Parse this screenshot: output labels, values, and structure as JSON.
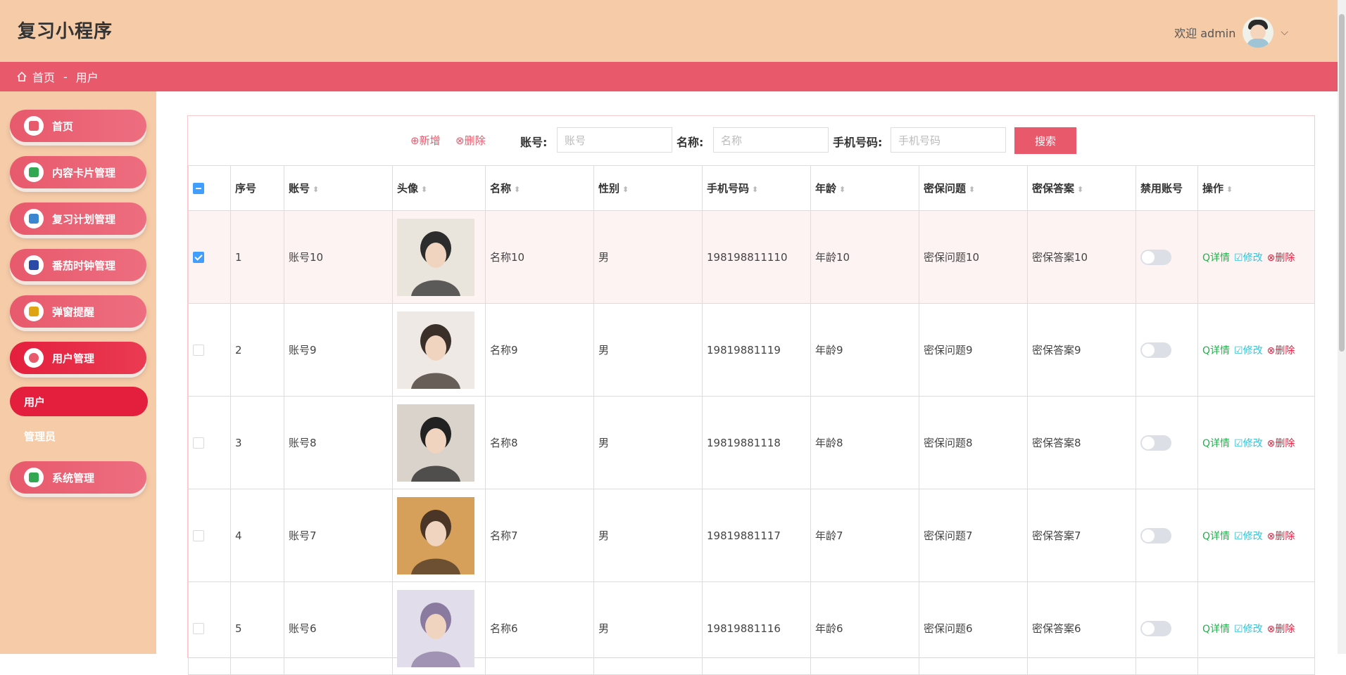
{
  "app_title": "复习小程序",
  "header": {
    "welcome": "欢迎 admin",
    "chevron": "⌵"
  },
  "breadcrumb": {
    "home": "首页",
    "sep": "-",
    "current": "用户"
  },
  "sidebar": {
    "items": [
      {
        "label": "首页",
        "icon": "home-icon",
        "color": "#e8596c"
      },
      {
        "label": "内容卡片管理",
        "icon": "card-icon",
        "color": "#33a852"
      },
      {
        "label": "复习计划管理",
        "icon": "building-icon",
        "color": "#3a86d1"
      },
      {
        "label": "番茄时钟管理",
        "icon": "book-icon",
        "color": "#2b4aa8"
      },
      {
        "label": "弹窗提醒",
        "icon": "folder-icon",
        "color": "#e0a412"
      },
      {
        "label": "用户管理",
        "icon": "user-icon",
        "color": "#e8596c"
      },
      {
        "label": "系统管理",
        "icon": "stack-icon",
        "color": "#33a852"
      }
    ],
    "sub_active": "用户",
    "sub_item": "管理员"
  },
  "toolbar": {
    "add": "⊕新增",
    "delete": "⊗删除",
    "account_label": "账号:",
    "account_placeholder": "账号",
    "name_label": "名称:",
    "name_placeholder": "名称",
    "phone_label": "手机号码:",
    "phone_placeholder": "手机号码",
    "search": "搜索"
  },
  "table": {
    "headers": [
      "序号",
      "账号",
      "头像",
      "名称",
      "性别",
      "手机号码",
      "年龄",
      "密保问题",
      "密保答案",
      "禁用账号",
      "操作"
    ],
    "rows": [
      {
        "seq": "1",
        "account": "账号10",
        "name": "名称10",
        "gender": "男",
        "phone": "198198811110",
        "age": "年龄10",
        "q": "密保问题10",
        "a": "密保答案10",
        "checked": true
      },
      {
        "seq": "2",
        "account": "账号9",
        "name": "名称9",
        "gender": "男",
        "phone": "19819881119",
        "age": "年龄9",
        "q": "密保问题9",
        "a": "密保答案9",
        "checked": false
      },
      {
        "seq": "3",
        "account": "账号8",
        "name": "名称8",
        "gender": "男",
        "phone": "19819881118",
        "age": "年龄8",
        "q": "密保问题8",
        "a": "密保答案8",
        "checked": false
      },
      {
        "seq": "4",
        "account": "账号7",
        "name": "名称7",
        "gender": "男",
        "phone": "19819881117",
        "age": "年龄7",
        "q": "密保问题7",
        "a": "密保答案7",
        "checked": false
      },
      {
        "seq": "5",
        "account": "账号6",
        "name": "名称6",
        "gender": "男",
        "phone": "19819881116",
        "age": "年龄6",
        "q": "密保问题6",
        "a": "密保答案6",
        "checked": false
      }
    ],
    "ops": {
      "detail": "Q详情",
      "edit": "☑修改",
      "delete": "⊗删除"
    }
  }
}
